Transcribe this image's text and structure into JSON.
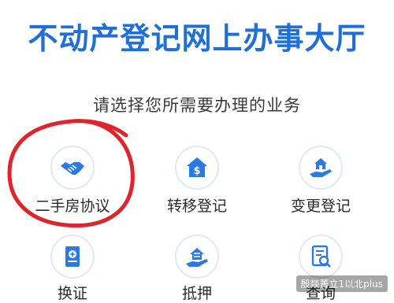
{
  "header": {
    "title": "不动产登记网上办事大厅",
    "subtitle": "请选择您所需要办理的业务"
  },
  "services": [
    {
      "label": "二手房协议",
      "icon": "handshake-icon",
      "highlighted": true
    },
    {
      "label": "转移登记",
      "icon": "house-money-icon",
      "highlighted": false
    },
    {
      "label": "变更登记",
      "icon": "house-hand-icon",
      "highlighted": false
    },
    {
      "label": "换证",
      "icon": "certificate-icon",
      "highlighted": false
    },
    {
      "label": "抵押",
      "icon": "house-mortgage-icon",
      "highlighted": false
    },
    {
      "label": "查询",
      "icon": "document-search-icon",
      "highlighted": false
    }
  ],
  "watermark": "殷燚菁立1以北plus",
  "colors": {
    "brand_blue": "#1f6fd8",
    "icon_blue": "#2a7ae2",
    "highlight_red": "#e0242b"
  }
}
